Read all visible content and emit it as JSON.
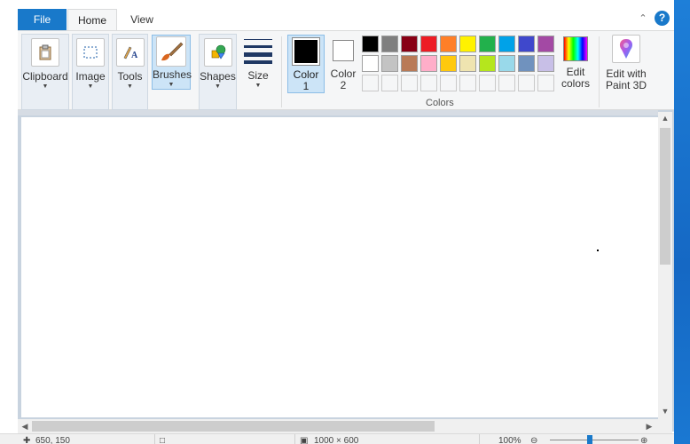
{
  "tabs": {
    "file": "File",
    "home": "Home",
    "view": "View"
  },
  "ribbon": {
    "clipboard": "Clipboard",
    "image": "Image",
    "tools": "Tools",
    "brushes": "Brushes",
    "shapes": "Shapes",
    "size": "Size",
    "color1": "Color\n1",
    "color1_a": "Color",
    "color1_b": "1",
    "color2_a": "Color",
    "color2_b": "2",
    "edit_colors_a": "Edit",
    "edit_colors_b": "colors",
    "edit_paint3d_a": "Edit with",
    "edit_paint3d_b": "Paint 3D",
    "colors_group": "Colors"
  },
  "palette_row1": [
    "#000000",
    "#7f7f7f",
    "#880015",
    "#ed1c24",
    "#ff7f27",
    "#fff200",
    "#22b14c",
    "#00a2e8",
    "#3f48cc",
    "#a349a4"
  ],
  "palette_row2": [
    "#ffffff",
    "#c3c3c3",
    "#b97a57",
    "#ffaec9",
    "#ffc90e",
    "#efe4b0",
    "#b5e61d",
    "#99d9ea",
    "#7092be",
    "#c8bfe7"
  ],
  "colors": {
    "color1": "#000000",
    "color2": "#ffffff",
    "accent": "#1979ca"
  },
  "statusbar": {
    "cursor_pos": "650, 150",
    "canvas_size": "1000 × 600",
    "zoom": "100%"
  }
}
